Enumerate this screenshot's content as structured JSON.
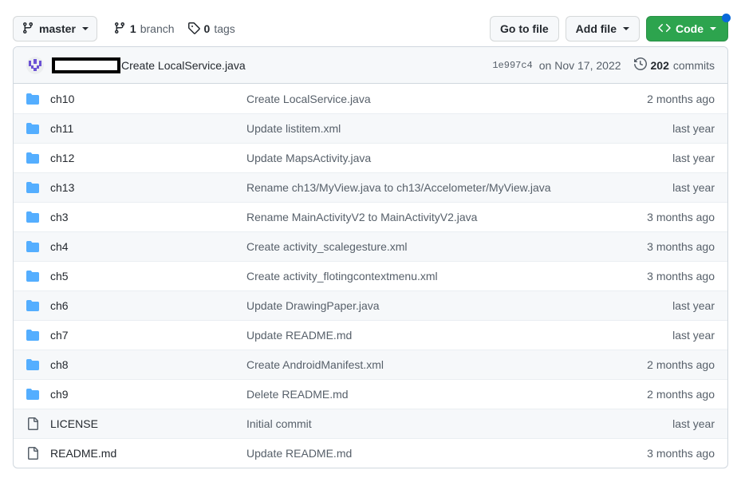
{
  "toolbar": {
    "branch_name": "master",
    "branch_icon": "git-branch-icon",
    "branch_count": "1",
    "branch_label": "branch",
    "tag_count": "0",
    "tag_label": "tags",
    "tag_icon": "tag-icon",
    "go_to_file": "Go to file",
    "add_file": "Add file",
    "code": "Code",
    "code_icon": "code-brackets-icon",
    "code_color": "#2da44e",
    "badge_color": "#0969da"
  },
  "commit_header": {
    "avatar": "user-avatar",
    "author_redacted": "",
    "message": "Create LocalService.java",
    "sha": "1e997c4",
    "date": "on Nov 17, 2022",
    "history_icon": "history-clock-icon",
    "commit_count": "202",
    "commits_label": "commits"
  },
  "files": {
    "folder_icon": "folder-icon",
    "file_icon": "file-icon",
    "folder_color": "#54aeff",
    "rows": [
      {
        "type": "folder",
        "name": "ch10",
        "message": "Create LocalService.java",
        "age": "2 months ago"
      },
      {
        "type": "folder",
        "name": "ch11",
        "message": "Update listitem.xml",
        "age": "last year"
      },
      {
        "type": "folder",
        "name": "ch12",
        "message": "Update MapsActivity.java",
        "age": "last year"
      },
      {
        "type": "folder",
        "name": "ch13",
        "message": "Rename ch13/MyView.java to ch13/Accelometer/MyView.java",
        "age": "last year"
      },
      {
        "type": "folder",
        "name": "ch3",
        "message": "Rename MainActivityV2 to MainActivityV2.java",
        "age": "3 months ago"
      },
      {
        "type": "folder",
        "name": "ch4",
        "message": "Create activity_scalegesture.xml",
        "age": "3 months ago"
      },
      {
        "type": "folder",
        "name": "ch5",
        "message": "Create activity_flotingcontextmenu.xml",
        "age": "3 months ago"
      },
      {
        "type": "folder",
        "name": "ch6",
        "message": "Update DrawingPaper.java",
        "age": "last year"
      },
      {
        "type": "folder",
        "name": "ch7",
        "message": "Update README.md",
        "age": "last year"
      },
      {
        "type": "folder",
        "name": "ch8",
        "message": "Create AndroidManifest.xml",
        "age": "2 months ago"
      },
      {
        "type": "folder",
        "name": "ch9",
        "message": "Delete README.md",
        "age": "2 months ago"
      },
      {
        "type": "file",
        "name": "LICENSE",
        "message": "Initial commit",
        "age": "last year"
      },
      {
        "type": "file",
        "name": "README.md",
        "message": "Update README.md",
        "age": "3 months ago"
      }
    ]
  }
}
